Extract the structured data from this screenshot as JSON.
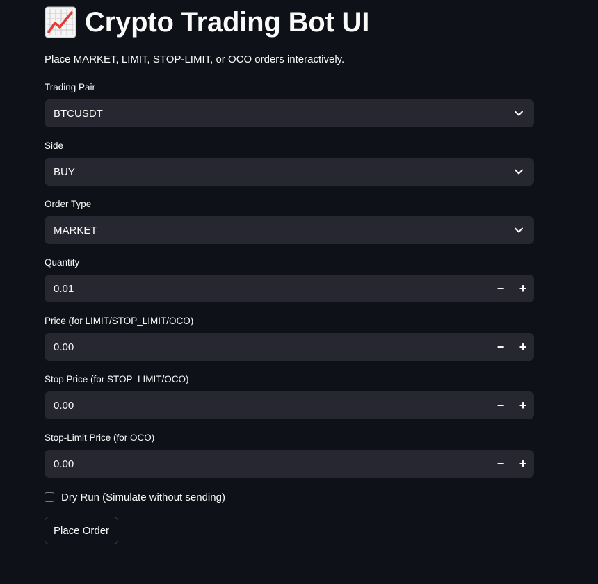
{
  "header": {
    "title_emoji": "chart-increasing-icon",
    "title": "Crypto Trading Bot UI",
    "subtitle": "Place MARKET, LIMIT, STOP-LIMIT, or OCO orders interactively."
  },
  "form": {
    "trading_pair": {
      "label": "Trading Pair",
      "value": "BTCUSDT",
      "icon": "chevron-down-icon"
    },
    "side": {
      "label": "Side",
      "value": "BUY",
      "icon": "chevron-down-icon"
    },
    "order_type": {
      "label": "Order Type",
      "value": "MARKET",
      "icon": "chevron-down-icon"
    },
    "quantity": {
      "label": "Quantity",
      "value": "0.01",
      "minus": "−",
      "plus": "+"
    },
    "price": {
      "label": "Price (for LIMIT/STOP_LIMIT/OCO)",
      "value": "0.00",
      "minus": "−",
      "plus": "+"
    },
    "stop_price": {
      "label": "Stop Price (for STOP_LIMIT/OCO)",
      "value": "0.00",
      "minus": "−",
      "plus": "+"
    },
    "stop_limit_price": {
      "label": "Stop-Limit Price (for OCO)",
      "value": "0.00",
      "minus": "−",
      "plus": "+"
    },
    "dry_run": {
      "label": "Dry Run (Simulate without sending)",
      "checked": false
    },
    "submit": {
      "label": "Place Order"
    }
  },
  "colors": {
    "background": "#0e1117",
    "input_background": "#262730",
    "text": "#fafafa",
    "chart_line": "#e53935"
  }
}
